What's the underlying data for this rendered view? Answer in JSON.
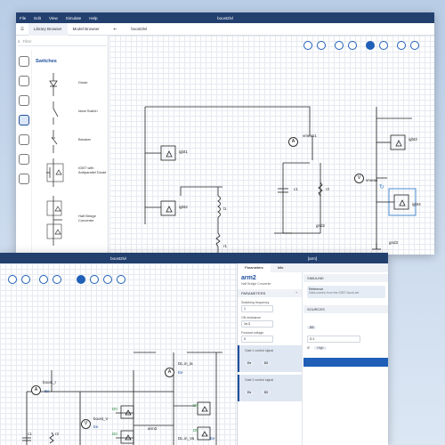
{
  "back_window": {
    "title": "boost2lvl",
    "menu": [
      "File",
      "Edit",
      "View",
      "Simulate",
      "Help"
    ],
    "tabs": [
      "Library Browser",
      "Model Browser"
    ],
    "canvas_tab": "boost2lvl",
    "search_placeholder": "Filter",
    "category": "Switches",
    "library_items": [
      "Diode",
      "Ideal Switch",
      "Breaker",
      "IGBT with Antiparallel Diode",
      "Half Bridge Converter"
    ],
    "labels": {
      "vmeas1": "vmeas1",
      "igbt1": "igbt1",
      "igbt2": "igbt2",
      "igbt3": "igbt3",
      "igbt4": "igbt4",
      "c1": "c1",
      "r2": "r2",
      "l1": "l1",
      "r1": "r1",
      "gnd2": "gnd2",
      "gnd3": "gnd3",
      "vmeas": "vmeas",
      "meter_a": "A",
      "meter_v": "V"
    }
  },
  "front_window": {
    "title": "boost2lvl",
    "right_title": "[arm]",
    "labels": {
      "boost_i": "boost_I",
      "ee1": "Ee",
      "boost_v": "boost_V",
      "ee2": "Ee",
      "dl_in_la": "DL.in_la",
      "ee3": "Ee",
      "arm2": "arm2",
      "dl_in_va": "DL.in_Va",
      "ee4": "Ee",
      "d0a": "D0",
      "d0b": "D0",
      "d0c": "D0",
      "d0d": "D0",
      "c1": "c1",
      "r2": "r2",
      "meter_a": "A",
      "meter_v": "V"
    },
    "panel": {
      "tabs": [
        "Parameters",
        "Info"
      ],
      "component_name": "arm2",
      "component_type": "Half Bridge Converter",
      "section_parameters": "PARAMETERS",
      "params": [
        {
          "label": "Switching frequency",
          "value": "1"
        },
        {
          "label": "ON resistance",
          "value": "1e-3"
        },
        {
          "label": "Forward voltage",
          "value": "0"
        }
      ],
      "gate_rows": [
        {
          "label": "Gate 1 control signal",
          "chip1": "Ee",
          "chip2": "D0"
        },
        {
          "label": "Gate 2 control signal",
          "chip1": "Ee",
          "chip2": "D0"
        }
      ],
      "simulink_title": "SIMULINK",
      "simulink_item": "Reference",
      "simulink_note": "Data comes from the IGBT block set",
      "sources_title": "SOURCES",
      "source_chip": "D0",
      "source_select": "D.1",
      "source_value": "High",
      "source_ie": "IE"
    }
  },
  "colors": {
    "titlebar": "#223f6e",
    "accent": "#1d4e9c",
    "button": "#1f5fb8"
  }
}
